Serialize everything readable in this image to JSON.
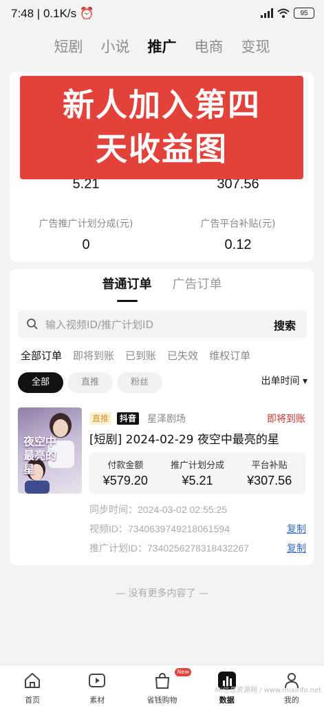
{
  "status_bar": {
    "time_speed": "7:48 | 0.1K/s",
    "battery": "95"
  },
  "top_tabs": [
    "短剧",
    "小说",
    "推广",
    "电商",
    "变现"
  ],
  "banner": {
    "line1": "新人加入第四",
    "line2": "天收益图"
  },
  "stats": {
    "top_left_value": "5.21",
    "top_right_value": "307.56",
    "ad_share_label": "广告推广计划分成(元)",
    "ad_share_value": "0",
    "ad_subsidy_label": "广告平台补贴(元)",
    "ad_subsidy_value": "0.12"
  },
  "order_tabs": [
    "普通订单",
    "广告订单"
  ],
  "search": {
    "placeholder": "输入视频ID/推广计划ID",
    "button": "搜索"
  },
  "filters": [
    "全部订单",
    "即将到账",
    "已到账",
    "已失效",
    "维权订单"
  ],
  "chips": [
    "全部",
    "直推",
    "粉丝"
  ],
  "sort_label": "出单时间 ▾",
  "order": {
    "poster_title": "夜空中最亮的星",
    "tag_direct": "直推",
    "tag_platform": "抖音",
    "theater": "星泽剧场",
    "status": "即将到账",
    "title": "[短剧] 2024-02-29 夜空中最亮的星",
    "amounts": [
      {
        "label": "付款金额",
        "value": "¥579.20"
      },
      {
        "label": "推广计划分成",
        "value": "¥5.21"
      },
      {
        "label": "平台补贴",
        "value": "¥307.56"
      }
    ],
    "sync_time": "同步时间：2024-03-02 02:55:25",
    "video_id": "视频ID：7340639749218061594",
    "plan_id": "推广计划ID：7340256278318432267",
    "copy_label": "复制"
  },
  "no_more": "— 没有更多内容了 —",
  "bottom_nav": [
    {
      "label": "首页",
      "icon": "home-icon"
    },
    {
      "label": "素材",
      "icon": "play-icon"
    },
    {
      "label": "省钱购物",
      "icon": "shopping-bag-icon",
      "badge": "New"
    },
    {
      "label": "数据",
      "icon": "chart-icon"
    },
    {
      "label": "我的",
      "icon": "user-icon"
    }
  ],
  "watermark": "Mi信息资源网 / www.mixinfo.net"
}
